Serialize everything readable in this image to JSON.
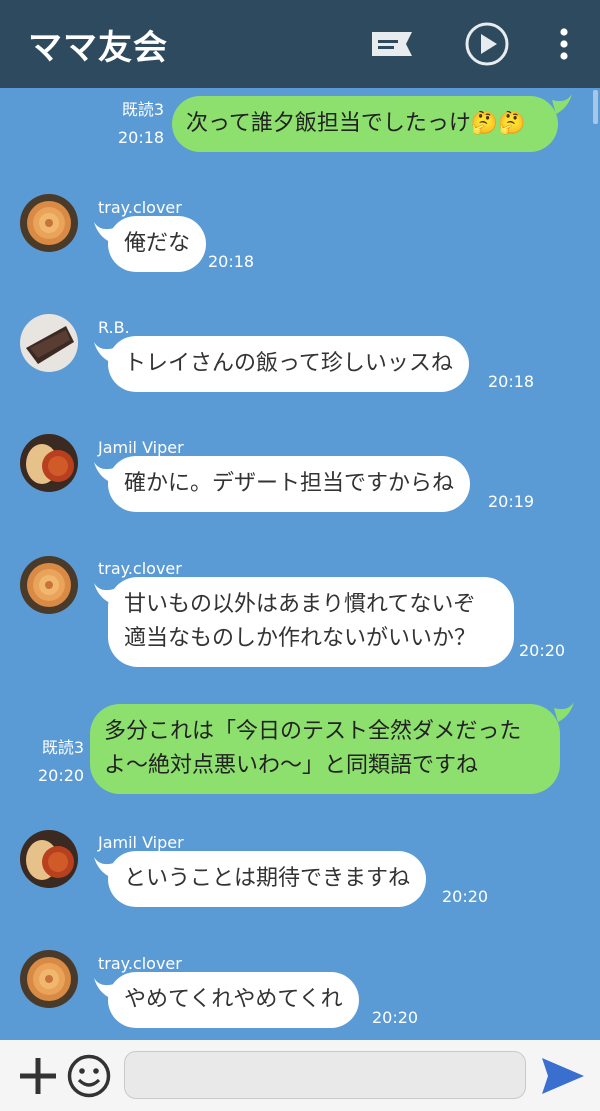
{
  "header": {
    "title": "ママ友会",
    "icons": [
      "note-icon",
      "play-icon",
      "more-vert-icon"
    ]
  },
  "messages": [
    {
      "side": "out",
      "read": "既読3",
      "time": "20:18",
      "lines": [
        "次って誰夕飯担当でしたっけ🤔🤔"
      ]
    },
    {
      "side": "in",
      "sender": "tray.clover",
      "avatar": "rose-pie",
      "time": "20:18",
      "lines": [
        "俺だな"
      ]
    },
    {
      "side": "in",
      "sender": "R.B.",
      "avatar": "chocolate-tart",
      "time": "20:18",
      "lines": [
        "トレイさんの飯って珍しいッスね"
      ]
    },
    {
      "side": "in",
      "sender": "Jamil Viper",
      "avatar": "curry",
      "time": "20:19",
      "lines": [
        "確かに。デザート担当ですからね"
      ]
    },
    {
      "side": "in",
      "sender": "tray.clover",
      "avatar": "rose-pie",
      "time": "20:20",
      "lines": [
        "甘いもの以外はあまり慣れてないぞ",
        "適当なものしか作れないがいいか？"
      ]
    },
    {
      "side": "out",
      "read": "既読3",
      "time": "20:20",
      "lines": [
        "多分これは「今日のテスト全然ダメだった",
        "よ〜絶対点悪いわ〜」と同類語ですね"
      ]
    },
    {
      "side": "in",
      "sender": "Jamil Viper",
      "avatar": "curry",
      "time": "20:20",
      "lines": [
        "ということは期待できますね"
      ]
    },
    {
      "side": "in",
      "sender": "tray.clover",
      "avatar": "rose-pie",
      "time": "20:20",
      "lines": [
        "やめてくれやめてくれ"
      ]
    }
  ],
  "composer": {
    "placeholder": "",
    "icons": [
      "plus-icon",
      "emoji-icon",
      "send-icon"
    ]
  },
  "colors": {
    "header_bg": "#2e4a5e",
    "chat_bg": "#5b9bd5",
    "outgoing_bubble": "#8ee06e",
    "incoming_bubble": "#ffffff",
    "send_accent": "#3a6fd0"
  }
}
